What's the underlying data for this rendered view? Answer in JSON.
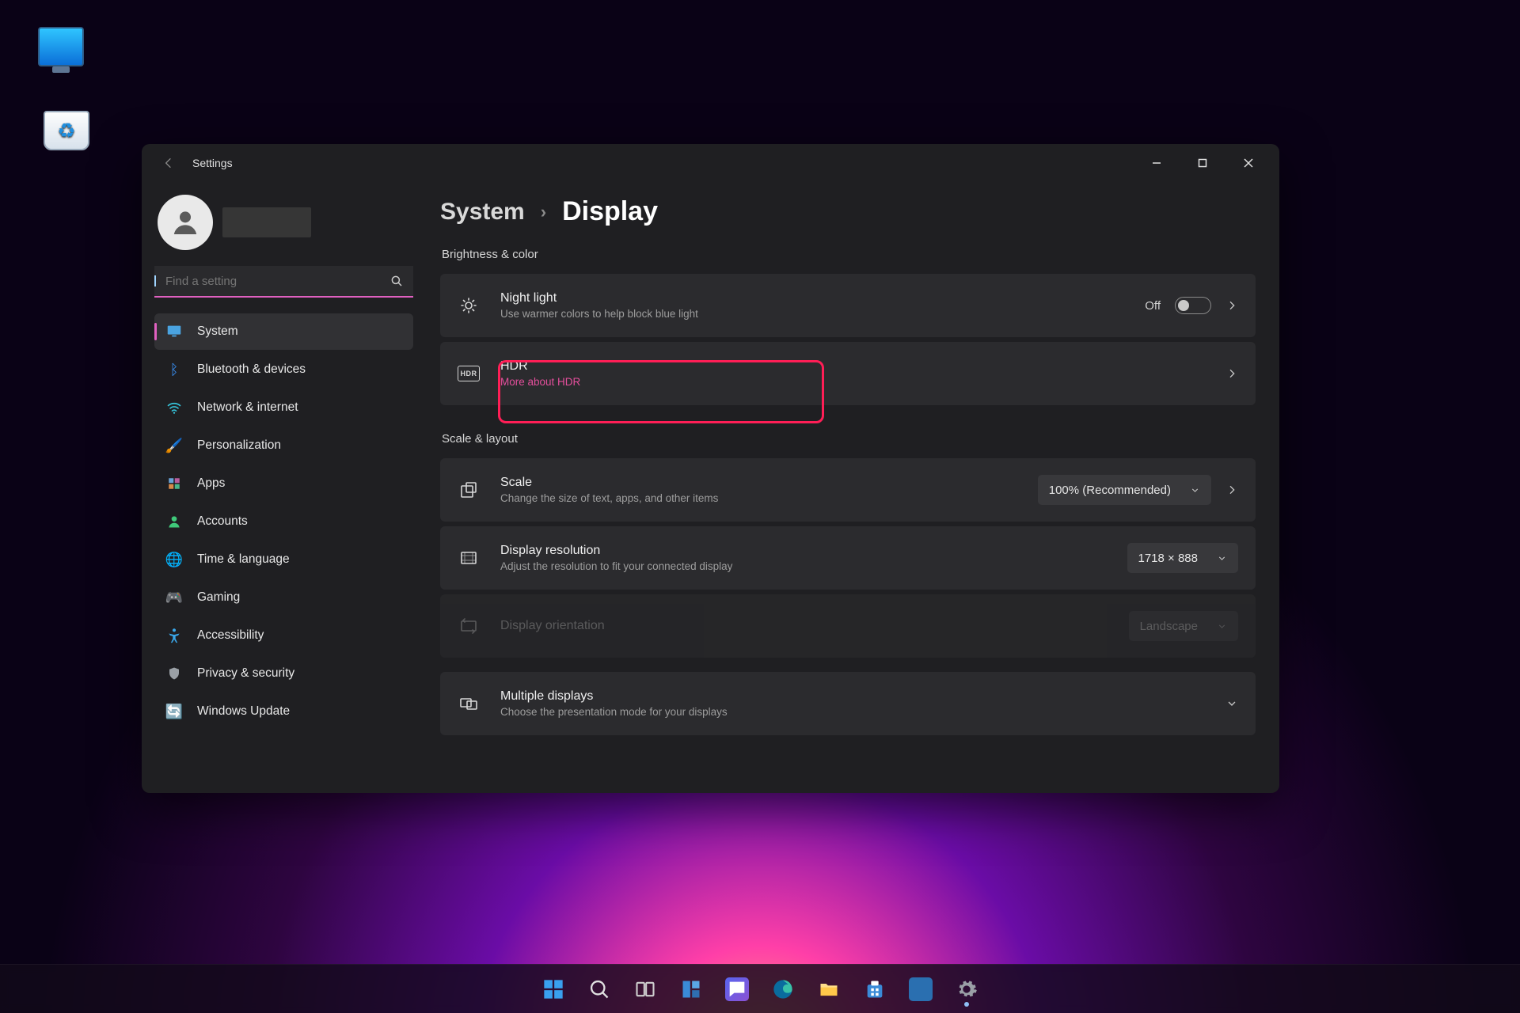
{
  "window": {
    "app_title": "Settings",
    "breadcrumb": {
      "parent": "System",
      "current": "Display"
    }
  },
  "search": {
    "placeholder": "Find a setting"
  },
  "sidebar": {
    "items": [
      {
        "label": "System"
      },
      {
        "label": "Bluetooth & devices"
      },
      {
        "label": "Network & internet"
      },
      {
        "label": "Personalization"
      },
      {
        "label": "Apps"
      },
      {
        "label": "Accounts"
      },
      {
        "label": "Time & language"
      },
      {
        "label": "Gaming"
      },
      {
        "label": "Accessibility"
      },
      {
        "label": "Privacy & security"
      },
      {
        "label": "Windows Update"
      }
    ]
  },
  "sections": {
    "brightness": "Brightness & color",
    "scale": "Scale & layout"
  },
  "cards": {
    "night_light": {
      "title": "Night light",
      "sub": "Use warmer colors to help block blue light",
      "state": "Off"
    },
    "hdr": {
      "title": "HDR",
      "sub": "More about HDR"
    },
    "scale": {
      "title": "Scale",
      "sub": "Change the size of text, apps, and other items",
      "value": "100% (Recommended)"
    },
    "resolution": {
      "title": "Display resolution",
      "sub": "Adjust the resolution to fit your connected display",
      "value": "1718 × 888"
    },
    "orientation": {
      "title": "Display orientation",
      "value": "Landscape"
    },
    "multiple": {
      "title": "Multiple displays",
      "sub": "Choose the presentation mode for your displays"
    }
  },
  "desktop_icons": {
    "this_pc": "",
    "recycle": ""
  }
}
